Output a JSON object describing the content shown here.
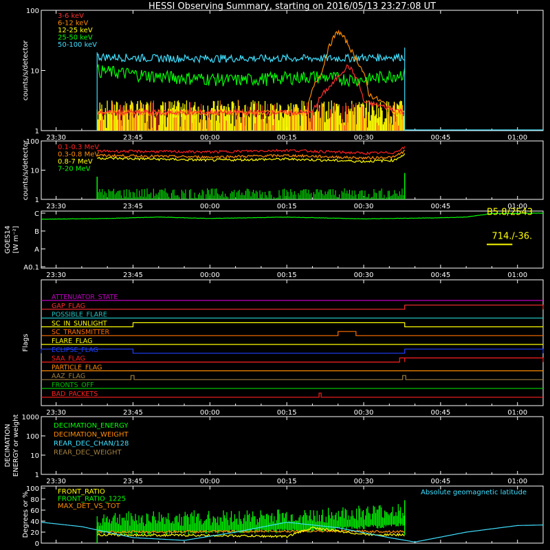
{
  "title": "HESSI Observing Summary, starting on 2016/05/13 23:27:08 UT",
  "time_axis": {
    "start_minutes": 1407.1,
    "end_minutes": 1505,
    "tick_minutes": [
      1410,
      1425,
      1440,
      1455,
      1470,
      1485,
      1500
    ],
    "tick_labels": [
      "23:30",
      "23:45",
      "00:00",
      "00:15",
      "00:30",
      "00:45",
      "01:00"
    ]
  },
  "chart_data": [
    {
      "id": "lightcurves",
      "type": "line",
      "ylabel": "counts/s/detector",
      "yscale": "log",
      "ylim": [
        1,
        100
      ],
      "ytick_labels": [
        "1",
        "10",
        "100"
      ],
      "series": [
        {
          "name": "3-6 keV",
          "color": "#ff3030",
          "x": [
            1418,
            1460,
            1464,
            1467,
            1470,
            1478
          ],
          "y": [
            2,
            2,
            6,
            12,
            3,
            2
          ]
        },
        {
          "name": "6-12 keV",
          "color": "#ff8c00",
          "x": [
            1418,
            1459,
            1462,
            1465,
            1468,
            1471,
            1476,
            1478
          ],
          "y": [
            2,
            2,
            10,
            45,
            18,
            4,
            2,
            2
          ]
        },
        {
          "name": "12-25 keV",
          "color": "#ffff00",
          "x": [
            1418,
            1478
          ],
          "y": [
            1.5,
            1.5
          ]
        },
        {
          "name": "25-50 keV",
          "color": "#00ff00",
          "x": [
            1418,
            1430,
            1445,
            1460,
            1470,
            1478
          ],
          "y": [
            10,
            8,
            7,
            8,
            7,
            9
          ]
        },
        {
          "name": "50-100 keV",
          "color": "#40e0ff",
          "x": [
            1418,
            1430,
            1450,
            1465,
            1478
          ],
          "y": [
            17,
            16,
            16,
            16,
            17
          ]
        }
      ]
    },
    {
      "id": "high_energy",
      "type": "line",
      "ylabel": "counts/s/detector",
      "yscale": "log",
      "ylim": [
        1,
        100
      ],
      "ytick_labels": [
        "1",
        "10",
        "100"
      ],
      "series": [
        {
          "name": "0.1-0.3 MeV",
          "color": "#ff2020",
          "x": [
            1418,
            1440,
            1455,
            1470,
            1476,
            1478
          ],
          "y": [
            45,
            42,
            48,
            38,
            40,
            60
          ]
        },
        {
          "name": "0.3-0.8 MeV",
          "color": "#ff8c00",
          "x": [
            1418,
            1440,
            1455,
            1470,
            1476,
            1478
          ],
          "y": [
            32,
            28,
            32,
            26,
            28,
            45
          ]
        },
        {
          "name": "0.8-7 MeV",
          "color": "#ffff00",
          "x": [
            1418,
            1440,
            1455,
            1470,
            1476,
            1478
          ],
          "y": [
            26,
            22,
            24,
            20,
            22,
            35
          ]
        },
        {
          "name": "7-20 MeV",
          "color": "#00ff00",
          "x": [
            1418,
            1478
          ],
          "y": [
            1.5,
            1.5
          ]
        }
      ]
    },
    {
      "id": "goes",
      "type": "line",
      "ylabel": "GOES14",
      "ylabel2": "[W m⁻²]",
      "ytick_labels": [
        "A0.1",
        "A",
        "B",
        "C"
      ],
      "level_min": 0,
      "level_max": 3,
      "series": [
        {
          "name": "GOES",
          "color": "#00ff00",
          "x": [
            1407.1,
            1420,
            1430,
            1440,
            1455,
            1470,
            1485,
            1490,
            1495,
            1505
          ],
          "y": [
            2.66,
            2.7,
            2.78,
            2.7,
            2.78,
            2.68,
            2.74,
            2.78,
            2.98,
            3.0
          ]
        }
      ],
      "annotations": [
        {
          "text": "B5.8/2543",
          "color": "#ffff00"
        },
        {
          "text": "714./-36.",
          "color": "#ffff00"
        }
      ],
      "marker": {
        "x_start": 1494,
        "x_end": 1499,
        "level": 1.25,
        "color": "#ffff00"
      }
    },
    {
      "id": "flags",
      "type": "line",
      "ylabel": "Flags",
      "rows": [
        {
          "label": "ATTENUATOR_STATE",
          "color": "#c000c0",
          "segments": []
        },
        {
          "label": "GAP_FLAG",
          "color": "#ff3030",
          "segments": [
            [
              1478,
              1505
            ]
          ]
        },
        {
          "label": "POSSIBLE_FLARE",
          "color": "#20c0c0",
          "segments": []
        },
        {
          "label": "SC_IN_SUNLIGHT",
          "color": "#ffff00",
          "segments": [
            [
              1425,
              1478
            ]
          ]
        },
        {
          "label": "SC_TRANSMITTER",
          "color": "#ff7000",
          "segments": [
            [
              1465,
              1468.5
            ]
          ]
        },
        {
          "label": "FLARE_FLAG",
          "color": "#ffff00",
          "segments": []
        },
        {
          "label": "ECLIPSE_FLAG",
          "color": "#2040ff",
          "segments": [
            [
              1407.1,
              1425
            ],
            [
              1478,
              1505
            ]
          ]
        },
        {
          "label": "SAA_FLAG",
          "color": "#ff2020",
          "segments": [
            [
              1477,
              1478
            ],
            [
              1478,
              1505
            ]
          ]
        },
        {
          "label": "PARTICLE_FLAG",
          "color": "#ff8c00",
          "segments": []
        },
        {
          "label": "AAZ_FLAG",
          "color": "#a08040",
          "segments": [
            [
              1424.6,
              1425.2
            ],
            [
              1477.6,
              1478.2
            ]
          ]
        },
        {
          "label": "FRONTS_OFF",
          "color": "#00c000",
          "segments": []
        },
        {
          "label": "BAD_PACKETS",
          "color": "#ff2020",
          "segments": [
            [
              1461.3,
              1461.7
            ]
          ]
        }
      ]
    },
    {
      "id": "decimation",
      "type": "line",
      "ylabel": "DECIMATION",
      "ylabel2": "ENERGY or weight",
      "yscale": "log",
      "ylim": [
        1,
        1000
      ],
      "ytick_labels": [
        "1",
        "10",
        "100",
        "1000"
      ],
      "series": [
        {
          "name": "DECIMATION_ENERGY",
          "color": "#00ff00",
          "x": [],
          "y": []
        },
        {
          "name": "DECIMATION_WEIGHT",
          "color": "#ff8c00",
          "x": [],
          "y": []
        },
        {
          "name": "REAR_DEC_CHAN/128",
          "color": "#40e0ff",
          "x": [],
          "y": []
        },
        {
          "name": "REAR_DEC_WEIGHT",
          "color": "#a08040",
          "x": [],
          "y": []
        }
      ]
    },
    {
      "id": "ratios",
      "type": "line",
      "ylabel": "Degrees or %",
      "ylim": [
        0,
        100
      ],
      "ytick_labels": [
        "0",
        "20",
        "40",
        "60",
        "80",
        "100"
      ],
      "series": [
        {
          "name": "FRONT_RATIO",
          "color": "#ffff00",
          "x": [
            1418,
            1440,
            1455,
            1460,
            1470,
            1478
          ],
          "y": [
            15,
            14,
            12,
            28,
            16,
            15
          ]
        },
        {
          "name": "FRONT_RATIO_1225",
          "color": "#00ff00",
          "x": [
            1418,
            1440,
            1460,
            1478
          ],
          "y": [
            30,
            32,
            35,
            45
          ]
        },
        {
          "name": "MAX_DET_VS_TOT",
          "color": "#ff8c00",
          "x": [
            1418,
            1440,
            1460,
            1478
          ],
          "y": [
            20,
            21,
            22,
            21
          ]
        },
        {
          "name": "Absolute geomagnetic latitude",
          "color": "#40e0ff",
          "x": [
            1407.1,
            1415,
            1425,
            1435,
            1445,
            1455,
            1465,
            1475,
            1480,
            1490,
            1500,
            1505
          ],
          "y": [
            38,
            30,
            10,
            5,
            20,
            38,
            28,
            10,
            2,
            20,
            32,
            33
          ]
        }
      ]
    }
  ]
}
